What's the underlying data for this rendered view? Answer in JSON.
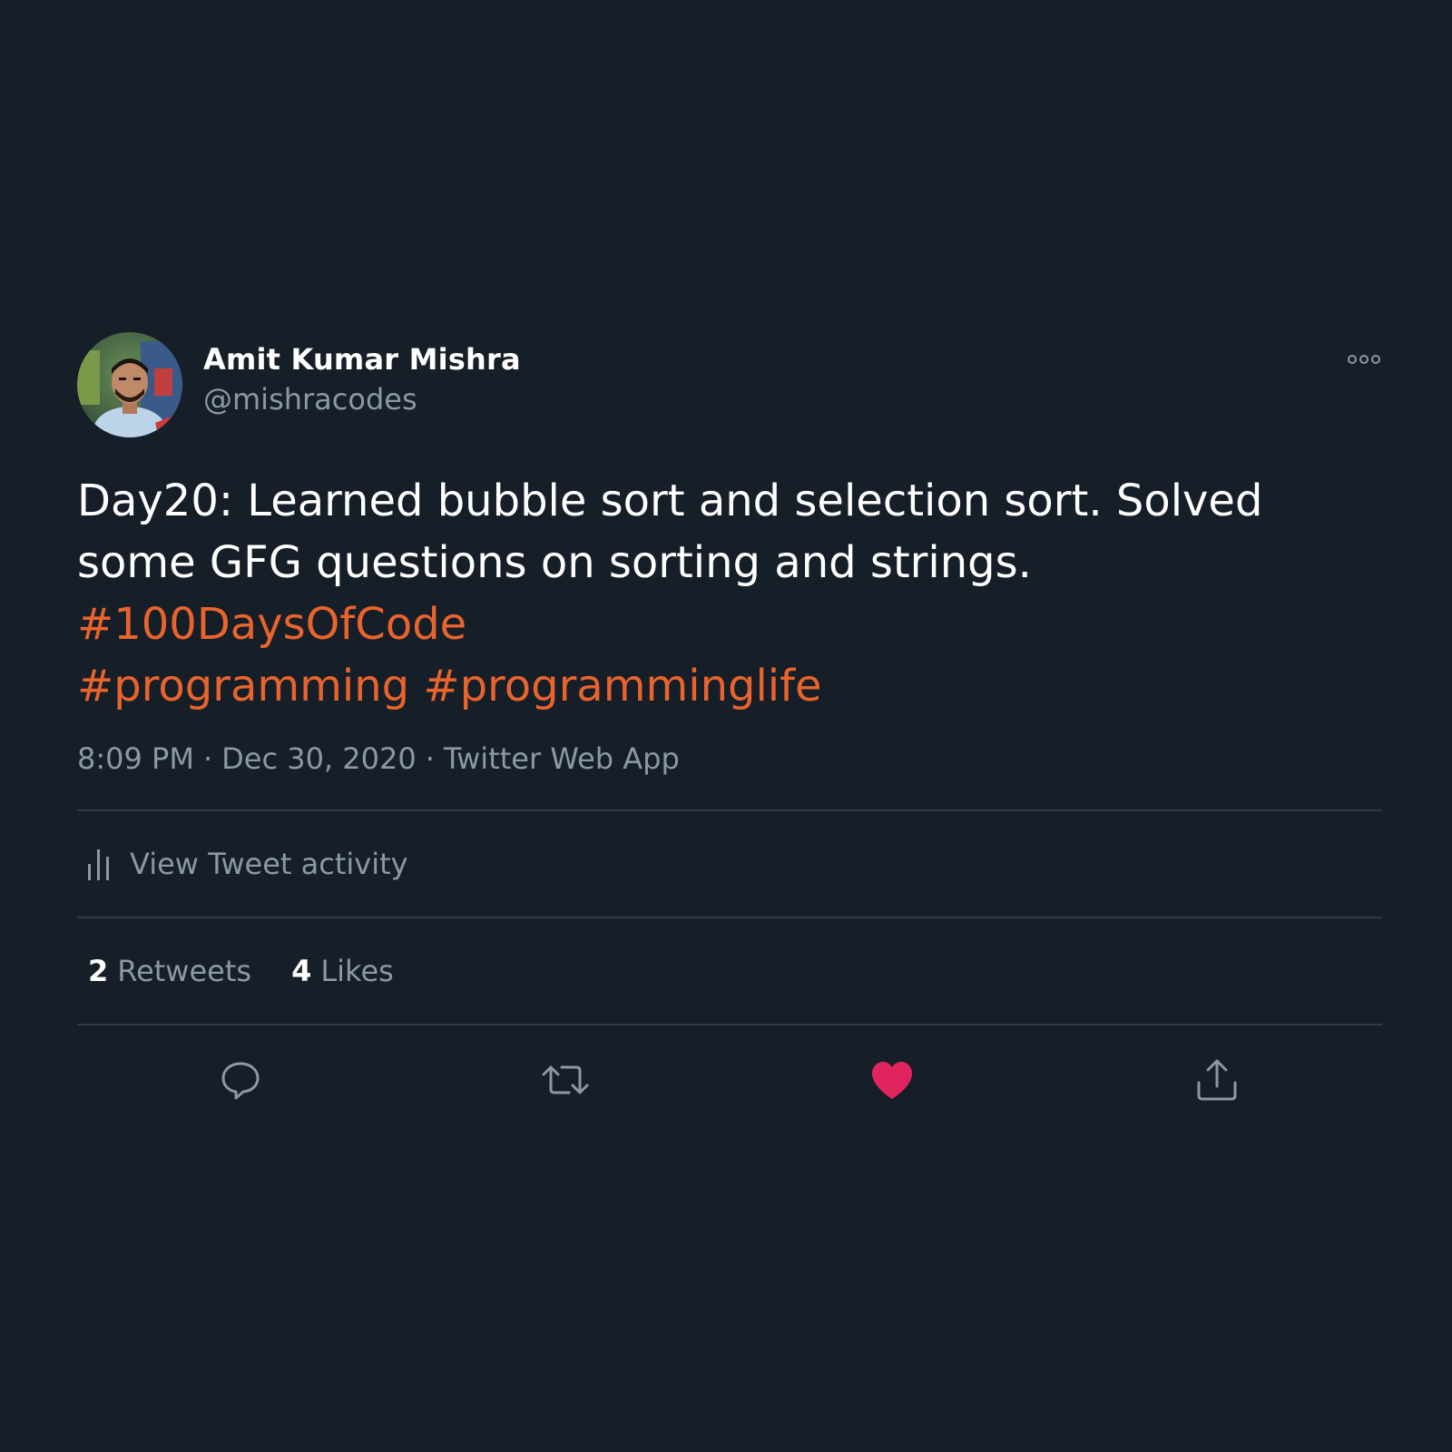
{
  "author": {
    "display_name": "Amit Kumar Mishra",
    "handle": "@mishracodes"
  },
  "tweet": {
    "line1": "Day20: Learned bubble sort and selection sort. Solved some GFG questions on sorting and strings.",
    "hashtags": [
      "#100DaysOfCode",
      "#programming",
      "#programminglife"
    ],
    "time": "8:09 PM",
    "date": "Dec 30, 2020",
    "source": "Twitter Web App",
    "separator": "·"
  },
  "activity": {
    "label": "View Tweet activity"
  },
  "stats": {
    "retweets_count": "2",
    "retweets_label": "Retweets",
    "likes_count": "4",
    "likes_label": "Likes"
  },
  "icons": {
    "more": "more-dots-icon",
    "activity": "bar-chart-icon",
    "reply": "reply-bubble-icon",
    "retweet": "retweet-icon",
    "like": "heart-icon",
    "share": "share-upload-icon"
  },
  "colors": {
    "background": "#161e28",
    "hashtag": "#e8642c",
    "secondary_text": "#8b98a5",
    "like_active": "#e0245e",
    "divider": "#2f3a45"
  }
}
